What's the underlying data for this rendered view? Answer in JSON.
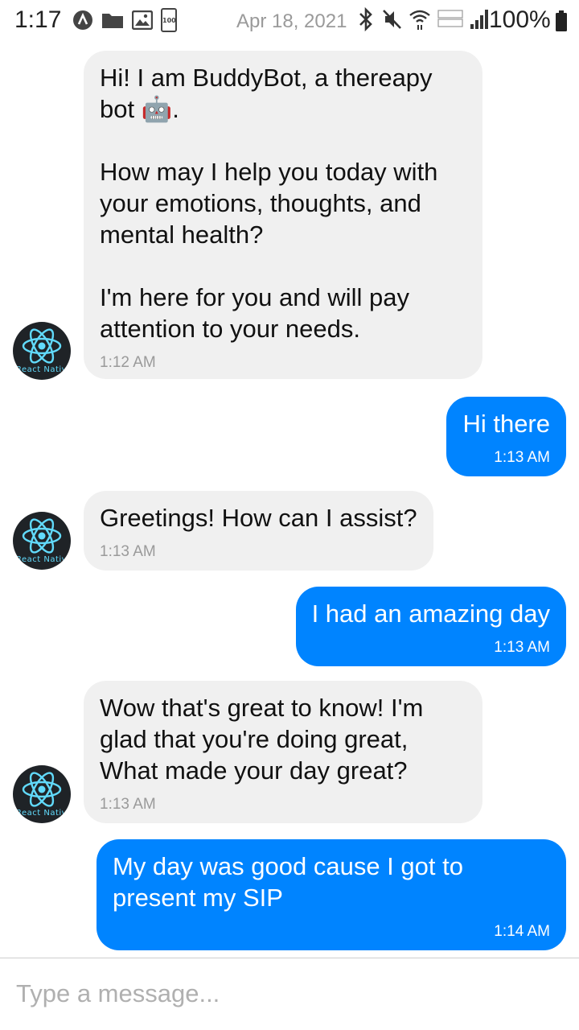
{
  "status_bar": {
    "time": "1:17",
    "date": "Apr 18, 2021",
    "battery_percent": "100%",
    "notification_badge": "100"
  },
  "avatar": {
    "label": "React Native"
  },
  "messages": [
    {
      "sender": "bot",
      "text": "Hi! I am BuddyBot, a thereapy bot 🤖.\n\nHow may I help you today with your emotions, thoughts, and mental health?\n\nI'm here for you and will pay attention to your needs.",
      "time": "1:12 AM"
    },
    {
      "sender": "user",
      "text": "Hi there",
      "time": "1:13 AM"
    },
    {
      "sender": "bot",
      "text": "Greetings! How can I assist?",
      "time": "1:13 AM"
    },
    {
      "sender": "user",
      "text": "I had an amazing day",
      "time": "1:13 AM"
    },
    {
      "sender": "bot",
      "text": "Wow that's great to know! I'm glad that you're doing great, What made your day great?",
      "time": "1:13 AM"
    },
    {
      "sender": "user",
      "text": "My day was good cause I got to present my SIP",
      "time": "1:14 AM"
    }
  ],
  "composer": {
    "placeholder": "Type a message...",
    "value": ""
  },
  "colors": {
    "user_bubble": "#0084ff",
    "bot_bubble": "#f0f0f0",
    "react_logo": "#61dafb"
  }
}
